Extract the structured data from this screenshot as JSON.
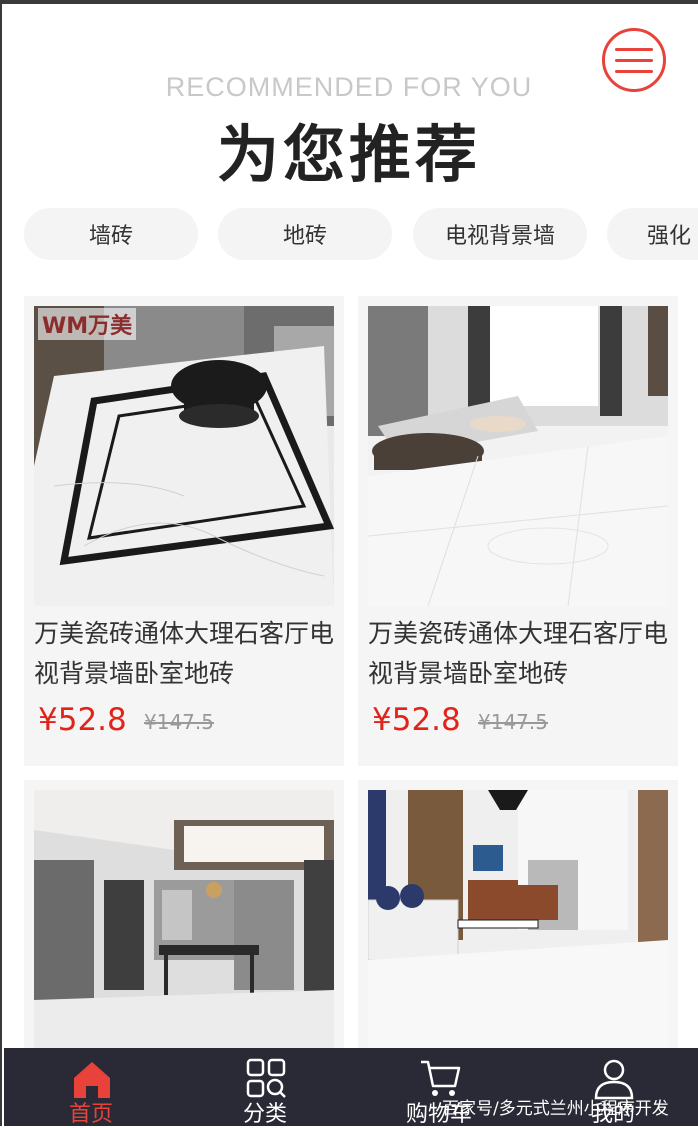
{
  "header": {
    "subtitle": "RECOMMENDED FOR YOU",
    "title": "为您推荐"
  },
  "categories": [
    "墙砖",
    "地砖",
    "电视背景墙",
    "强化"
  ],
  "products": [
    {
      "name": "万美瓷砖通体大理石客厅电视背景墙卧室地砖",
      "price": "¥52.8",
      "original_price": "¥147.5",
      "brand_logo": "万美瓷砖"
    },
    {
      "name": "万美瓷砖通体大理石客厅电视背景墙卧室地砖",
      "price": "¥52.8",
      "original_price": "¥147.5"
    },
    {
      "name": "",
      "price": "",
      "original_price": ""
    },
    {
      "name": "",
      "price": "",
      "original_price": ""
    }
  ],
  "tabbar": {
    "items": [
      {
        "label": "首页",
        "icon": "home-icon"
      },
      {
        "label": "分类",
        "icon": "grid-search-icon"
      },
      {
        "label": "购物车",
        "icon": "cart-icon"
      },
      {
        "label": "我的",
        "icon": "user-icon"
      }
    ]
  },
  "watermark": "百家号/多元式兰州小程序开发",
  "colors": {
    "accent": "#e8423a",
    "price": "#e2231a",
    "tabbar_bg": "#2a2a36"
  }
}
